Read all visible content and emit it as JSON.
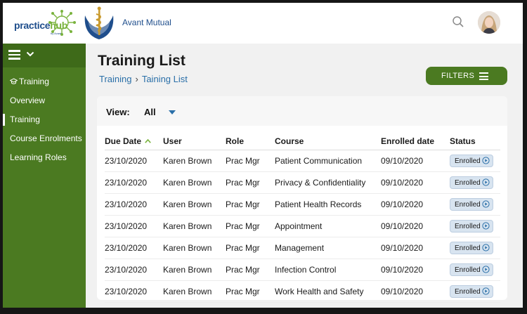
{
  "header": {
    "practice_logo": "practicehub",
    "practice_sub": "by Avant",
    "org_name": "Avant Mutual"
  },
  "sidebar": {
    "items": [
      {
        "label": "Training",
        "icon": "graduation-cap-icon"
      },
      {
        "label": "Overview"
      },
      {
        "label": "Training"
      },
      {
        "label": "Course Enrolments"
      },
      {
        "label": "Learning Roles"
      }
    ]
  },
  "page": {
    "title": "Training List",
    "breadcrumb": [
      "Training",
      "Taining List"
    ],
    "filters_label": "FILTERS"
  },
  "view": {
    "label": "View:",
    "value": "All"
  },
  "table": {
    "columns": [
      "Due Date",
      "User",
      "Role",
      "Course",
      "Enrolled date",
      "Status"
    ],
    "rows": [
      [
        "23/10/2020",
        "Karen Brown",
        "Prac Mgr",
        "Patient Communication",
        "09/10/2020",
        "Enrolled"
      ],
      [
        "23/10/2020",
        "Karen Brown",
        "Prac Mgr",
        "Privacy & Confidentiality",
        "09/10/2020",
        "Enrolled"
      ],
      [
        "23/10/2020",
        "Karen Brown",
        "Prac Mgr",
        "Patient Health Records",
        "09/10/2020",
        "Enrolled"
      ],
      [
        "23/10/2020",
        "Karen Brown",
        "Prac Mgr",
        "Appointment",
        "09/10/2020",
        "Enrolled"
      ],
      [
        "23/10/2020",
        "Karen Brown",
        "Prac Mgr",
        "Management",
        "09/10/2020",
        "Enrolled"
      ],
      [
        "23/10/2020",
        "Karen Brown",
        "Prac Mgr",
        "Infection Control",
        "09/10/2020",
        "Enrolled"
      ],
      [
        "23/10/2020",
        "Karen Brown",
        "Prac Mgr",
        "Work Health and Safety",
        "09/10/2020",
        "Enrolled"
      ]
    ]
  },
  "colors": {
    "brand_green": "#4b7a21",
    "link_blue": "#2a6fa8",
    "badge_bg": "#d8e4f0"
  }
}
